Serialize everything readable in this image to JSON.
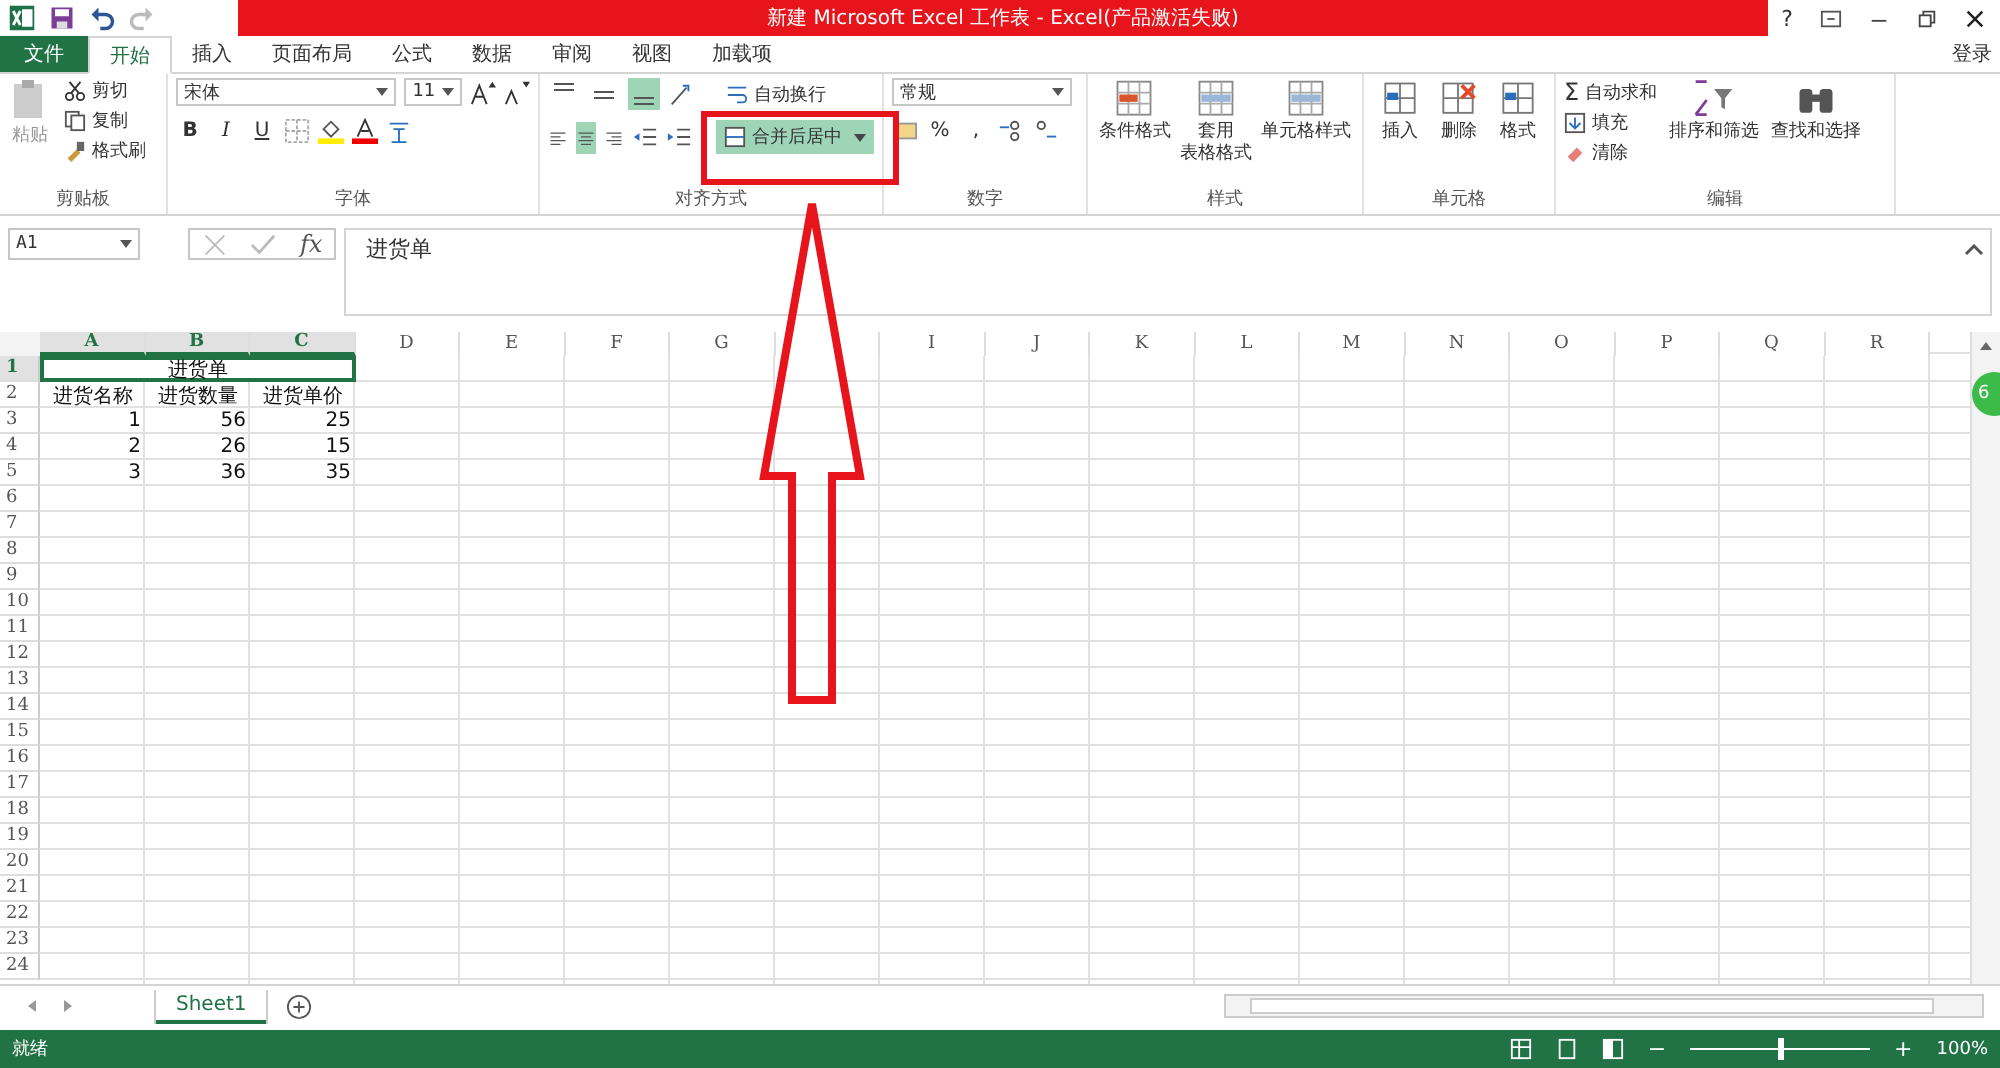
{
  "title_bar": {
    "title": "新建 Microsoft Excel 工作表 -  Excel(产品激活失败)",
    "help": "?"
  },
  "ribbon_tabs": [
    {
      "label": "文件",
      "kind": "file",
      "selected": false
    },
    {
      "label": "开始",
      "kind": "tab",
      "selected": true
    },
    {
      "label": "插入",
      "kind": "tab",
      "selected": false
    },
    {
      "label": "页面布局",
      "kind": "tab",
      "selected": false
    },
    {
      "label": "公式",
      "kind": "tab",
      "selected": false
    },
    {
      "label": "数据",
      "kind": "tab",
      "selected": false
    },
    {
      "label": "审阅",
      "kind": "tab",
      "selected": false
    },
    {
      "label": "视图",
      "kind": "tab",
      "selected": false
    },
    {
      "label": "加载项",
      "kind": "tab",
      "selected": false
    }
  ],
  "sign_in": "登录",
  "clipboard": {
    "label": "剪贴板",
    "paste": "粘贴",
    "cut": "剪切",
    "copy": "复制",
    "painter": "格式刷"
  },
  "font": {
    "label": "字体",
    "name": "宋体",
    "size": "11",
    "bold": "B",
    "italic": "I",
    "underline": "U"
  },
  "alignment": {
    "label": "对齐方式",
    "wrap": "自动换行",
    "merge": "合并后居中",
    "vertical": [
      {
        "kind": "top",
        "selected": false
      },
      {
        "kind": "middle",
        "selected": false
      },
      {
        "kind": "bottom",
        "selected": true
      }
    ],
    "horizontal": [
      {
        "kind": "left",
        "selected": false
      },
      {
        "kind": "center",
        "selected": true
      },
      {
        "kind": "right",
        "selected": false
      }
    ]
  },
  "number": {
    "label": "数字",
    "format": "常规",
    "percent": "%",
    "comma": ","
  },
  "styles": {
    "label": "样式",
    "items": [
      {
        "lines": [
          "条件格式"
        ]
      },
      {
        "lines": [
          "套用",
          "表格格式"
        ]
      },
      {
        "lines": [
          "单元格样式"
        ]
      }
    ]
  },
  "cells_group": {
    "label": "单元格",
    "items": [
      "插入",
      "删除",
      "格式"
    ]
  },
  "editing": {
    "label": "编辑",
    "sigma": "Σ",
    "autosum": "自动求和",
    "fill": "填充",
    "clear": "清除",
    "sort": "排序和筛选",
    "find": "查找和选择"
  },
  "formula_bar": {
    "name_box": "A1",
    "fx": "fx",
    "formula": "进货单"
  },
  "sheet": {
    "columns": [
      {
        "label": "A",
        "selected": true
      },
      {
        "label": "B",
        "selected": true
      },
      {
        "label": "C",
        "selected": true
      },
      {
        "label": "D",
        "selected": false
      },
      {
        "label": "E",
        "selected": false
      },
      {
        "label": "F",
        "selected": false
      },
      {
        "label": "G",
        "selected": false
      },
      {
        "selected": false
      },
      {
        "label": "I",
        "selected": false
      },
      {
        "label": "J",
        "selected": false
      },
      {
        "label": "K",
        "selected": false
      },
      {
        "label": "L",
        "selected": false
      },
      {
        "label": "M",
        "selected": false
      },
      {
        "label": "N",
        "selected": false
      },
      {
        "label": "O",
        "selected": false
      },
      {
        "label": "P",
        "selected": false
      },
      {
        "label": "Q",
        "selected": false
      },
      {
        "label": "R",
        "selected": false
      }
    ],
    "rows": [
      {
        "label": "1",
        "selected": true,
        "cells": [
          {
            "text": "进货单",
            "kind": "merged"
          }
        ]
      },
      {
        "label": "2",
        "selected": false,
        "cells": [
          {
            "text": "进货名称",
            "kind": "text"
          },
          {
            "text": "进货数量",
            "kind": "text"
          },
          {
            "text": "进货单价",
            "kind": "text"
          }
        ]
      },
      {
        "label": "3",
        "selected": false,
        "cells": [
          {
            "text": "1",
            "kind": "number"
          },
          {
            "text": "56",
            "kind": "number"
          },
          {
            "text": "25",
            "kind": "number"
          }
        ]
      },
      {
        "label": "4",
        "selected": false,
        "cells": [
          {
            "text": "2",
            "kind": "number"
          },
          {
            "text": "26",
            "kind": "number"
          },
          {
            "text": "15",
            "kind": "number"
          }
        ]
      },
      {
        "label": "5",
        "selected": false,
        "cells": [
          {
            "text": "3",
            "kind": "number"
          },
          {
            "text": "36",
            "kind": "number"
          },
          {
            "text": "35",
            "kind": "number"
          }
        ]
      },
      {
        "label": "6",
        "selected": false,
        "cells": []
      },
      {
        "label": "7",
        "selected": false,
        "cells": []
      },
      {
        "label": "8",
        "selected": false,
        "cells": []
      },
      {
        "label": "9",
        "selected": false,
        "cells": []
      },
      {
        "label": "10",
        "selected": false,
        "cells": []
      },
      {
        "label": "11",
        "selected": false,
        "cells": []
      },
      {
        "label": "12",
        "selected": false,
        "cells": []
      },
      {
        "label": "13",
        "selected": false,
        "cells": []
      },
      {
        "label": "14",
        "selected": false,
        "cells": []
      },
      {
        "label": "15",
        "selected": false,
        "cells": []
      },
      {
        "label": "16",
        "selected": false,
        "cells": []
      },
      {
        "label": "17",
        "selected": false,
        "cells": []
      },
      {
        "label": "18",
        "selected": false,
        "cells": []
      },
      {
        "label": "19",
        "selected": false,
        "cells": []
      },
      {
        "label": "20",
        "selected": false,
        "cells": []
      },
      {
        "label": "21",
        "selected": false,
        "cells": []
      },
      {
        "label": "22",
        "selected": false,
        "cells": []
      },
      {
        "label": "23",
        "selected": false,
        "cells": []
      },
      {
        "label": "24",
        "selected": false,
        "cells": []
      }
    ]
  },
  "sheet_tabs": [
    {
      "label": "Sheet1",
      "selected": true
    }
  ],
  "floating_badge": "6",
  "status_bar": {
    "status": "就绪",
    "zoom": "100%",
    "zoom_out": "−",
    "zoom_in": "+",
    "zoom_level": {
      "level": 0.5
    }
  }
}
